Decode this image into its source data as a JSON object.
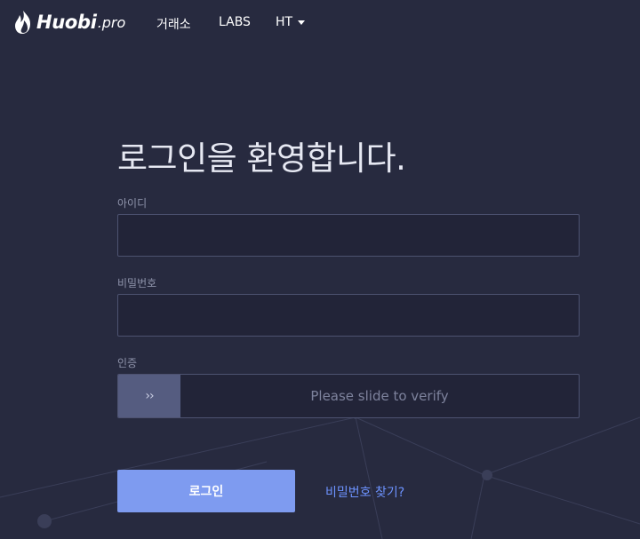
{
  "header": {
    "logo_text": "Huobi",
    "logo_suffix": ".pro",
    "nav": {
      "exchange": "거래소",
      "labs": "LABS",
      "ht": "HT"
    }
  },
  "login": {
    "title": "로그인을 환영합니다.",
    "id_label": "아이디",
    "id_value": "",
    "password_label": "비밀번호",
    "password_value": "",
    "auth_label": "인증",
    "slider_text": "Please slide to verify",
    "slider_icon": "double-chevron-right",
    "submit_label": "로그인",
    "forgot_label": "비밀번호 찾기?"
  },
  "colors": {
    "background": "#272a3f",
    "field_background": "#222438",
    "field_border": "#4d5270",
    "slider_handle": "#555c80",
    "primary_button": "#7e9bf0",
    "link": "#6d93ff"
  }
}
